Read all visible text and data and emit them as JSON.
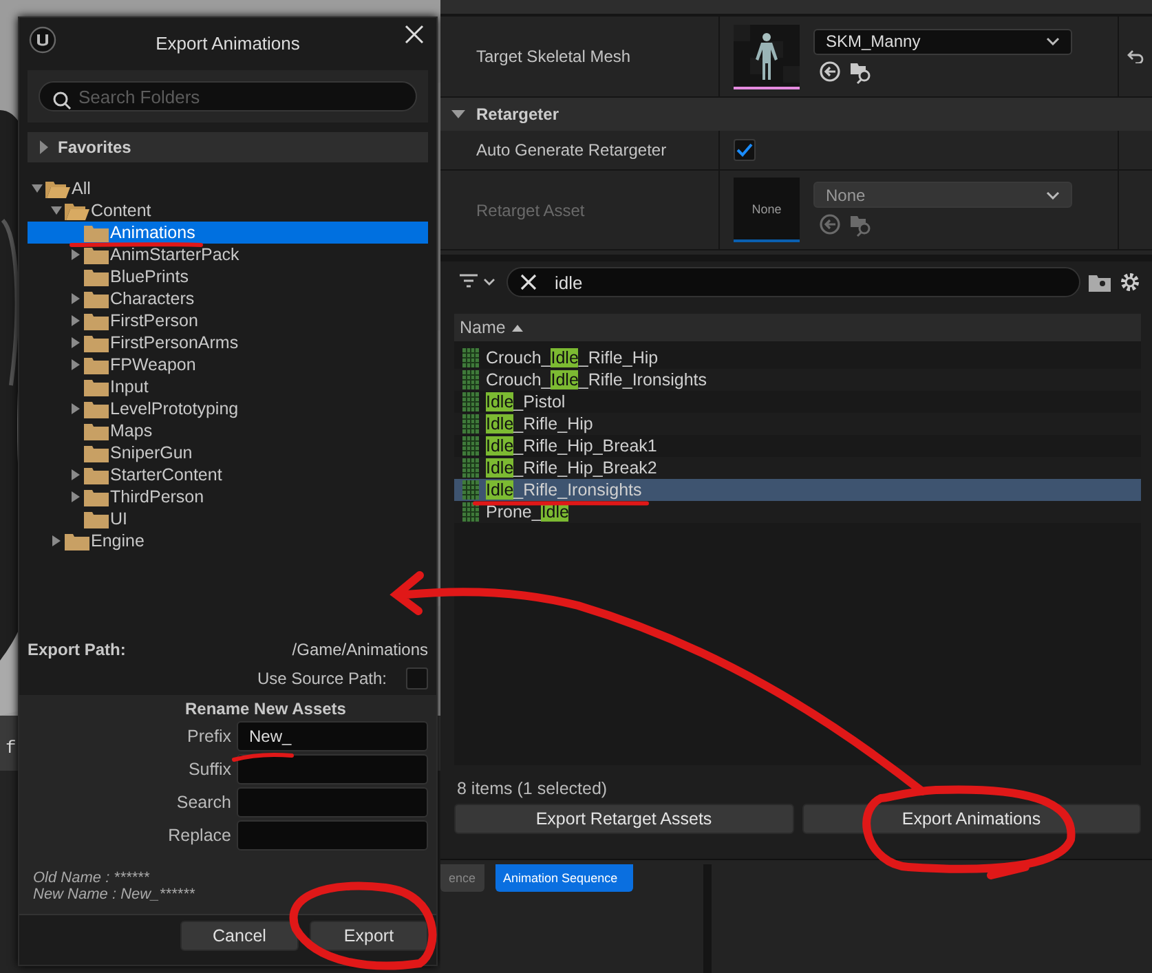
{
  "viewport": {
    "kind": "picture",
    "stray_text": "f"
  },
  "dialog": {
    "title": "Export Animations",
    "search": {
      "placeholder": "Search Folders"
    },
    "favorites": {
      "label": "Favorites",
      "expanded": false
    },
    "tree": [
      {
        "label": "All",
        "expandable": true,
        "expanded": true,
        "selected": false,
        "children": [
          {
            "label": "Content",
            "expandable": true,
            "expanded": true,
            "selected": false,
            "children": [
              {
                "label": "Animations",
                "expandable": false,
                "expanded": false,
                "selected": true
              },
              {
                "label": "AnimStarterPack",
                "expandable": true,
                "expanded": false,
                "selected": false
              },
              {
                "label": "BluePrints",
                "expandable": false,
                "expanded": false,
                "selected": false
              },
              {
                "label": "Characters",
                "expandable": true,
                "expanded": false,
                "selected": false
              },
              {
                "label": "FirstPerson",
                "expandable": true,
                "expanded": false,
                "selected": false
              },
              {
                "label": "FirstPersonArms",
                "expandable": true,
                "expanded": false,
                "selected": false
              },
              {
                "label": "FPWeapon",
                "expandable": true,
                "expanded": false,
                "selected": false
              },
              {
                "label": "Input",
                "expandable": false,
                "expanded": false,
                "selected": false
              },
              {
                "label": "LevelPrototyping",
                "expandable": true,
                "expanded": false,
                "selected": false
              },
              {
                "label": "Maps",
                "expandable": false,
                "expanded": false,
                "selected": false
              },
              {
                "label": "SniperGun",
                "expandable": false,
                "expanded": false,
                "selected": false
              },
              {
                "label": "StarterContent",
                "expandable": true,
                "expanded": false,
                "selected": false
              },
              {
                "label": "ThirdPerson",
                "expandable": true,
                "expanded": false,
                "selected": false
              },
              {
                "label": "UI",
                "expandable": false,
                "expanded": false,
                "selected": false
              }
            ]
          },
          {
            "label": "Engine",
            "expandable": true,
            "expanded": false,
            "selected": false
          }
        ]
      }
    ],
    "export_path": {
      "label": "Export Path:",
      "value": "/Game/Animations"
    },
    "use_source_path": {
      "label": "Use Source Path:",
      "checked": false
    },
    "rename": {
      "title": "Rename New Assets",
      "fields": [
        {
          "label": "Prefix",
          "value": "New_"
        },
        {
          "label": "Suffix"
        },
        {
          "label": "Search"
        },
        {
          "label": "Replace"
        }
      ]
    },
    "preview": [
      "Old Name : ******",
      "New Name : New_******"
    ],
    "buttons": [
      "Cancel",
      "Export"
    ]
  },
  "details": {
    "rows": [
      {
        "kind": "asset",
        "label": "Target Skeletal Mesh",
        "value": "SKM_Manny",
        "disabled": false,
        "reset": true
      },
      {
        "kind": "header",
        "label": "Retargeter",
        "expanded": true
      },
      {
        "kind": "checkbox",
        "label": "Auto Generate Retargeter",
        "checked": true
      },
      {
        "kind": "asset",
        "label": "Retarget Asset",
        "value": "None",
        "disabled": true,
        "thumbnail": {
          "kind": "text",
          "text": "None"
        },
        "reset": false
      }
    ]
  },
  "browser": {
    "search": {
      "value": "idle"
    },
    "columns": [
      {
        "label": "Name",
        "sorted_ascending": true
      }
    ],
    "rows": [
      {
        "segments": [
          {
            "text": "Crouch_",
            "highlight": false
          },
          {
            "text": "Idle",
            "highlight": true
          },
          {
            "text": "_Rifle_Hip",
            "highlight": false
          }
        ],
        "selected": false
      },
      {
        "segments": [
          {
            "text": "Crouch_",
            "highlight": false
          },
          {
            "text": "Idle",
            "highlight": true
          },
          {
            "text": "_Rifle_Ironsights",
            "highlight": false
          }
        ],
        "selected": false
      },
      {
        "segments": [
          {
            "text": "Idle",
            "highlight": true
          },
          {
            "text": "_Pistol",
            "highlight": false
          }
        ],
        "selected": false
      },
      {
        "segments": [
          {
            "text": "Idle",
            "highlight": true
          },
          {
            "text": "_Rifle_Hip",
            "highlight": false
          }
        ],
        "selected": false
      },
      {
        "segments": [
          {
            "text": "Idle",
            "highlight": true
          },
          {
            "text": "_Rifle_Hip_Break1",
            "highlight": false
          }
        ],
        "selected": false
      },
      {
        "segments": [
          {
            "text": "Idle",
            "highlight": true
          },
          {
            "text": "_Rifle_Hip_Break2",
            "highlight": false
          }
        ],
        "selected": false
      },
      {
        "segments": [
          {
            "text": "Idle",
            "highlight": true
          },
          {
            "text": "_Rifle_Ironsights",
            "highlight": false
          }
        ],
        "selected": true
      },
      {
        "segments": [
          {
            "text": "Prone_",
            "highlight": false
          },
          {
            "text": "Idle",
            "highlight": true
          }
        ],
        "selected": false
      }
    ],
    "status": "8 items (1 selected)",
    "buttons": [
      "Export Retarget Assets",
      "Export Animations"
    ]
  },
  "bottom_tabs": [
    {
      "label": "ence",
      "selected": false
    },
    {
      "label": "Animation Sequence",
      "selected": true
    }
  ],
  "annotations": [
    {
      "kind": "underline"
    },
    {
      "kind": "underline"
    },
    {
      "kind": "underline"
    },
    {
      "kind": "arrow"
    },
    {
      "kind": "circle"
    },
    {
      "kind": "circle"
    }
  ]
}
